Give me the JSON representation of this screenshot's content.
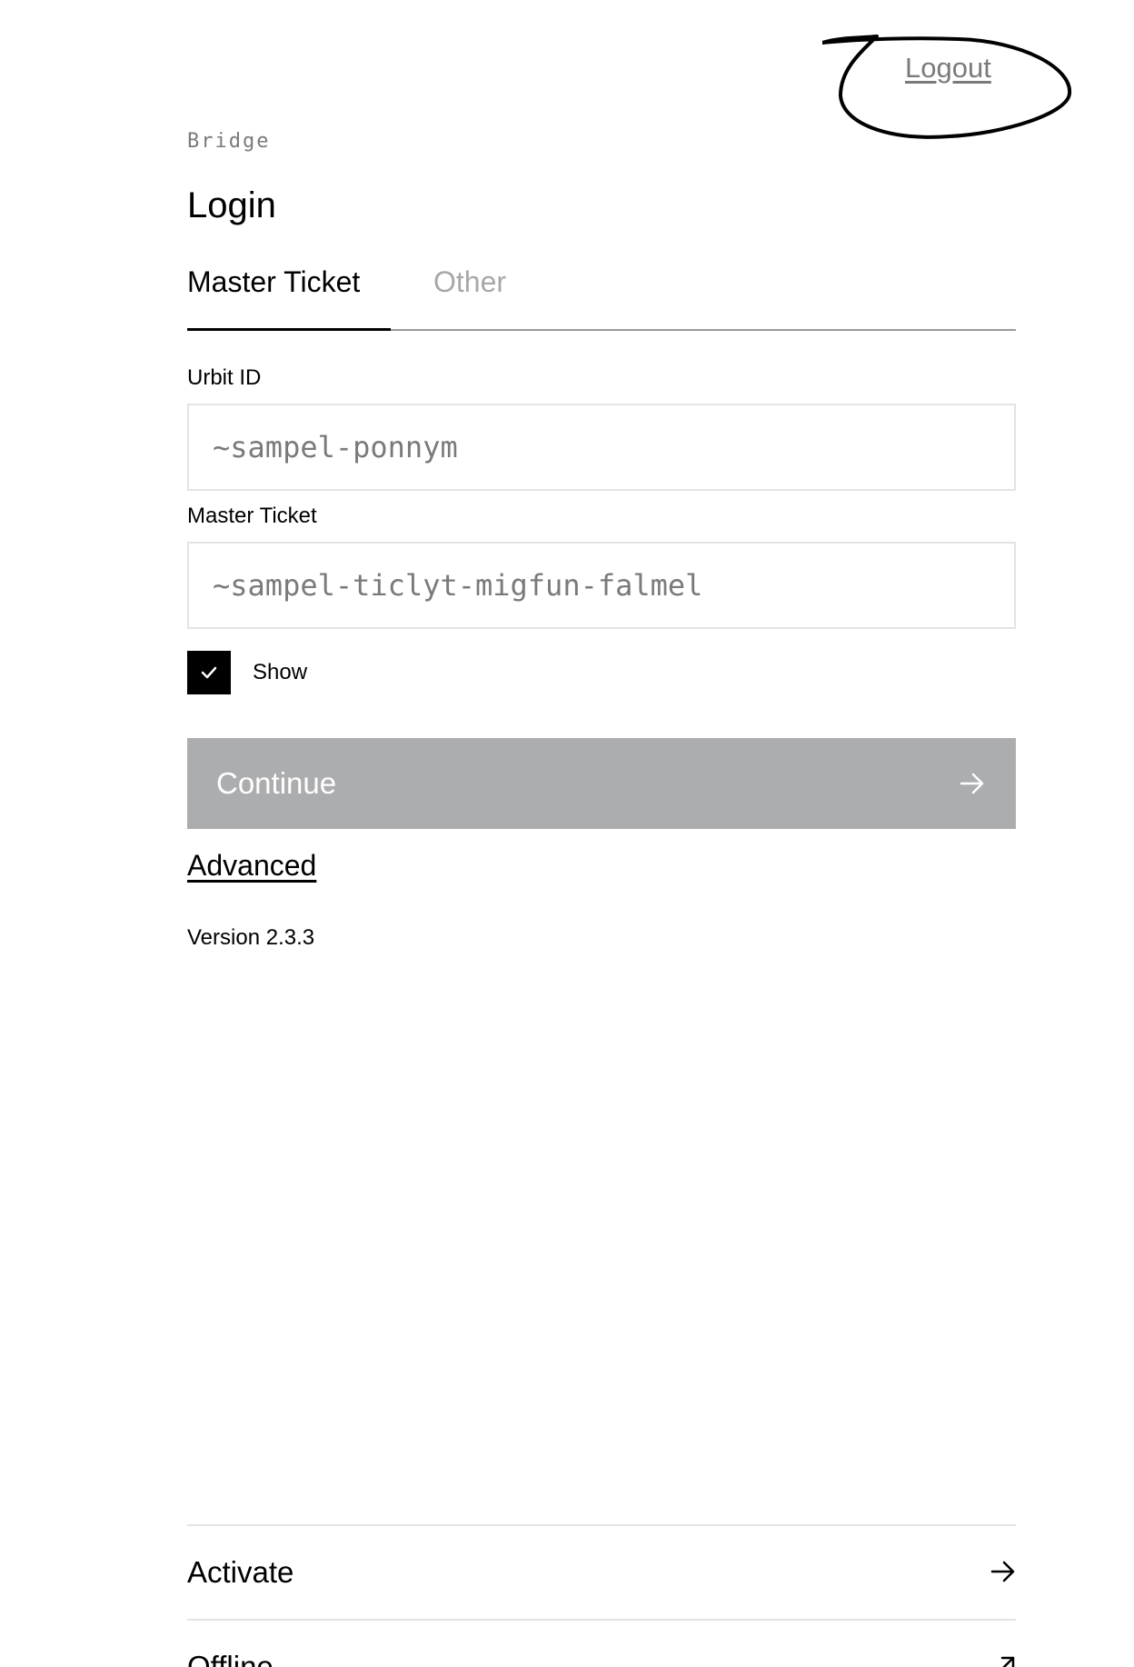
{
  "header": {
    "logout_label": "Logout"
  },
  "brand": {
    "name": "Bridge"
  },
  "page": {
    "title": "Login"
  },
  "tabs": [
    {
      "label": "Master Ticket",
      "active": true
    },
    {
      "label": "Other",
      "active": false
    }
  ],
  "form": {
    "urbit_id": {
      "label": "Urbit ID",
      "placeholder": "~sampel-ponnym",
      "value": ""
    },
    "master_ticket": {
      "label": "Master Ticket",
      "placeholder": "~sampel-ticlyt-migfun-falmel",
      "value": ""
    },
    "show_checkbox": {
      "label": "Show",
      "checked": true
    },
    "continue_button": {
      "label": "Continue",
      "icon": "arrow-right-icon",
      "disabled": true
    }
  },
  "advanced_link": "Advanced",
  "version": "Version 2.3.3",
  "bottom_nav": [
    {
      "label": "Activate",
      "icon": "arrow-right-icon"
    },
    {
      "label": "Offline",
      "icon": "arrow-up-right-icon"
    }
  ],
  "colors": {
    "accent": "#000000",
    "muted_text": "#7a7a7a",
    "disabled_button": "#acadaf",
    "input_border": "#e3e3e3",
    "annotation_stroke": "#000000"
  }
}
